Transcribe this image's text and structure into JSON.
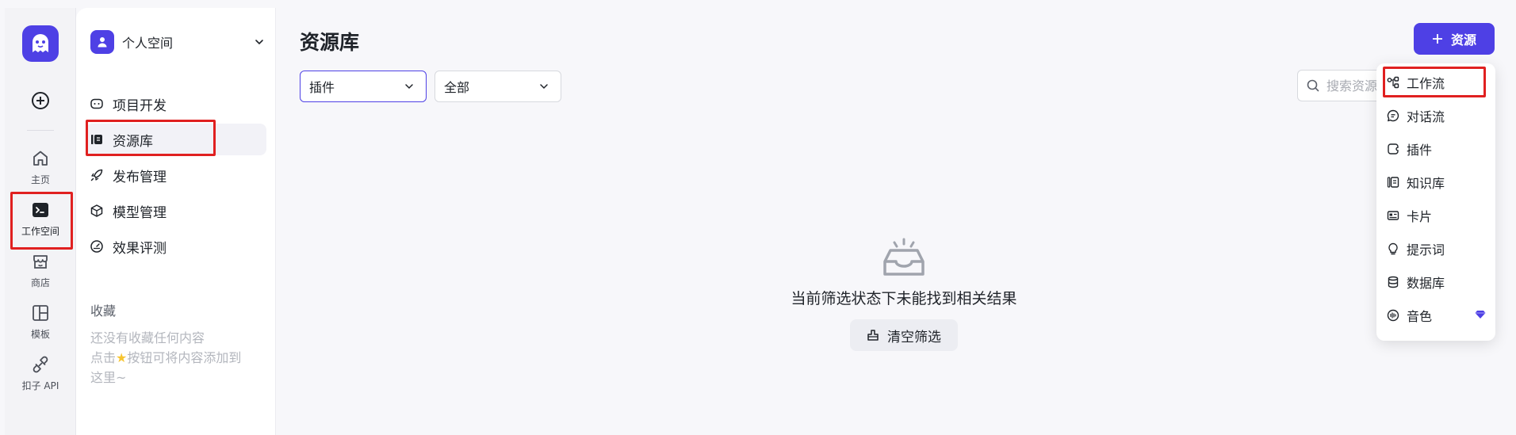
{
  "rail": {
    "items": [
      {
        "label": "主页",
        "icon": "home-icon"
      },
      {
        "label": "工作空间",
        "icon": "terminal-icon"
      },
      {
        "label": "商店",
        "icon": "store-icon"
      },
      {
        "label": "模板",
        "icon": "template-icon"
      },
      {
        "label": "扣子 API",
        "icon": "api-icon"
      }
    ]
  },
  "sidebar": {
    "space_name": "个人空间",
    "items": [
      {
        "label": "项目开发",
        "icon": "robot-icon"
      },
      {
        "label": "资源库",
        "icon": "library-icon"
      },
      {
        "label": "发布管理",
        "icon": "rocket-icon"
      },
      {
        "label": "模型管理",
        "icon": "model-icon"
      },
      {
        "label": "效果评测",
        "icon": "gauge-icon"
      }
    ],
    "favorites_title": "收藏",
    "favorites_empty_line1": "还没有收藏任何内容",
    "favorites_empty_line2_pre": "点击",
    "favorites_empty_line2_post": "按钮可将内容添加到",
    "favorites_empty_line3": "这里~"
  },
  "main": {
    "title": "资源库",
    "filter_type": "插件",
    "filter_scope": "全部",
    "search_placeholder": "搜索资源",
    "create_label": "资源",
    "empty_message": "当前筛选状态下未能找到相关结果",
    "clear_label": "清空筛选"
  },
  "dropdown": {
    "items": [
      {
        "label": "工作流",
        "icon": "workflow-icon"
      },
      {
        "label": "对话流",
        "icon": "chatflow-icon"
      },
      {
        "label": "插件",
        "icon": "plugin-icon"
      },
      {
        "label": "知识库",
        "icon": "knowledge-icon"
      },
      {
        "label": "卡片",
        "icon": "card-icon"
      },
      {
        "label": "提示词",
        "icon": "prompt-icon"
      },
      {
        "label": "数据库",
        "icon": "database-icon"
      },
      {
        "label": "音色",
        "icon": "voice-icon"
      }
    ]
  },
  "colors": {
    "accent": "#4e40e5",
    "highlight": "#e02020",
    "premium": "#4e40e5"
  }
}
